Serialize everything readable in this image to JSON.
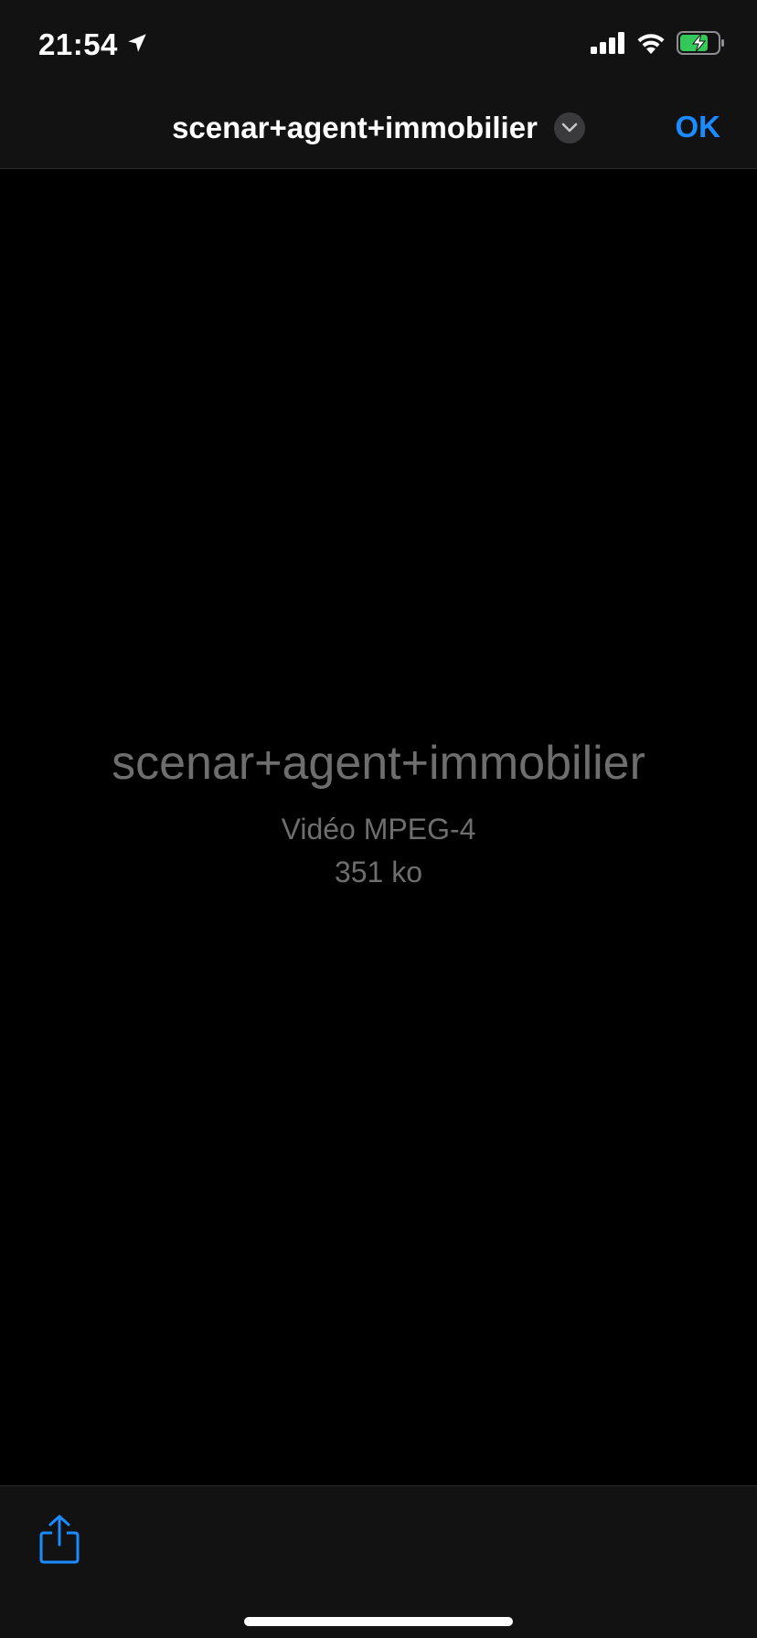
{
  "status_bar": {
    "time": "21:54",
    "icons": [
      "location-arrow-icon",
      "cellular-signal-icon",
      "wifi-icon",
      "battery-charging-icon"
    ],
    "battery_color": "#34c759"
  },
  "nav": {
    "title": "scenar+agent+immobilier",
    "ok_label": "OK",
    "accent_color": "#1a8cff"
  },
  "file": {
    "name": "scenar+agent+immobilier",
    "type": "Vidéo MPEG-4",
    "size": "351 ko"
  },
  "toolbar": {
    "icons": [
      "share-icon"
    ]
  }
}
